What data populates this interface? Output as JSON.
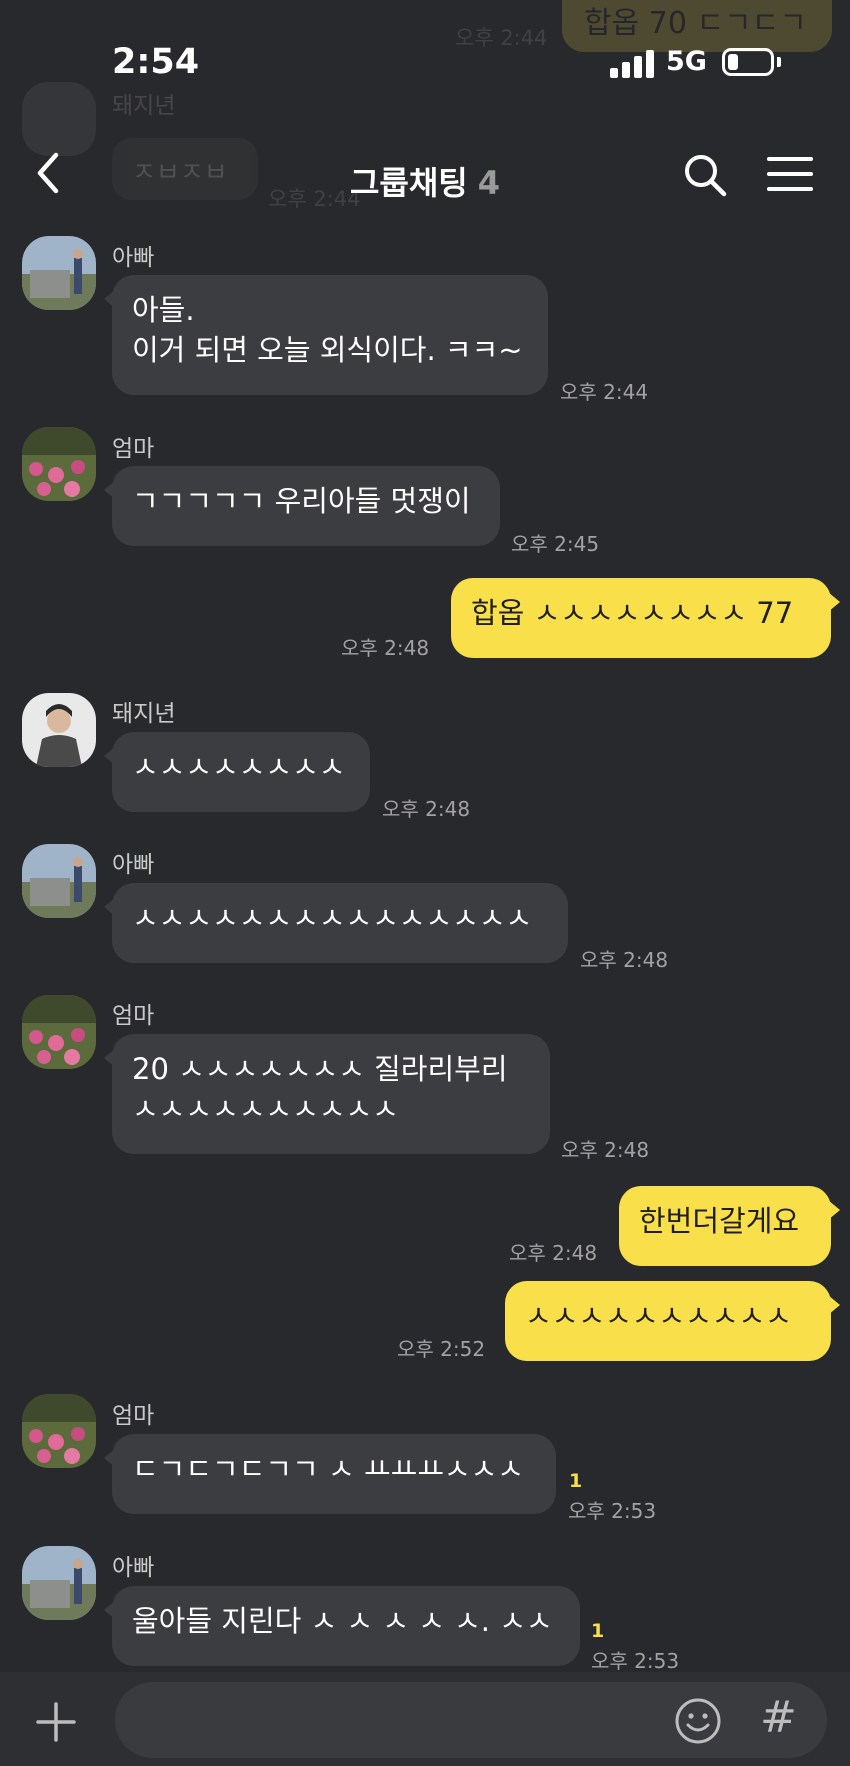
{
  "status_bar": {
    "time": "2:54",
    "network": "5G"
  },
  "header": {
    "title": "그룹채팅",
    "member_count": "4"
  },
  "ghost": {
    "top_bubble": "합옵 70 ㄷㄱㄷㄱ",
    "top_time": "오후 2:44",
    "name": "돼지년",
    "bubble": "ㅈㅂㅈㅂ",
    "time": "오후 2:44"
  },
  "messages": [
    {
      "direction": "in",
      "sender": "아빠",
      "text": "아들.\n이거 되면 오늘 외식이다. ㅋㅋ~",
      "time": "오후 2:44"
    },
    {
      "direction": "in",
      "sender": "엄마",
      "text": "ㄱㄱㄱㄱㄱ 우리아들 멋쟁이",
      "time": "오후 2:45"
    },
    {
      "direction": "out",
      "text": "합옵 ㅅㅅㅅㅅㅅㅅㅅㅅ 77",
      "time": "오후 2:48"
    },
    {
      "direction": "in",
      "sender": "돼지년",
      "text": "ㅅㅅㅅㅅㅅㅅㅅㅅ",
      "time": "오후 2:48"
    },
    {
      "direction": "in",
      "sender": "아빠",
      "text": "ㅅㅅㅅㅅㅅㅅㅅㅅㅅㅅㅅㅅㅅㅅㅅ",
      "time": "오후 2:48"
    },
    {
      "direction": "in",
      "sender": "엄마",
      "text": "20 ㅅㅅㅅㅅㅅㅅㅅ 질라리부리\nㅅㅅㅅㅅㅅㅅㅅㅅㅅㅅ",
      "time": "오후 2:48"
    },
    {
      "direction": "out",
      "text": "한번더갈게요",
      "time": "오후 2:48"
    },
    {
      "direction": "out",
      "text": "ㅅㅅㅅㅅㅅㅅㅅㅅㅅㅅ",
      "time": "오후 2:52"
    },
    {
      "direction": "in",
      "sender": "엄마",
      "text": "ㄷㄱㄷㄱㄷㄱㄱ ㅅ ㅛㅛㅛㅅㅅㅅ",
      "time": "오후 2:53",
      "unread": "1"
    },
    {
      "direction": "in",
      "sender": "아빠",
      "text": "울아들 지린다 ㅅ ㅅ ㅅ ㅅ ㅅ. ㅅㅅ",
      "time": "오후 2:53",
      "unread": "1"
    }
  ],
  "input": {
    "placeholder": ""
  },
  "colors": {
    "background": "#28292c",
    "incoming_bubble": "#3c3d41",
    "outgoing_bubble": "#f9e04b",
    "unread": "#f9e04b"
  },
  "icons": [
    "back-icon",
    "search-icon",
    "menu-icon",
    "plus-icon",
    "emoji-icon",
    "hash-icon"
  ]
}
